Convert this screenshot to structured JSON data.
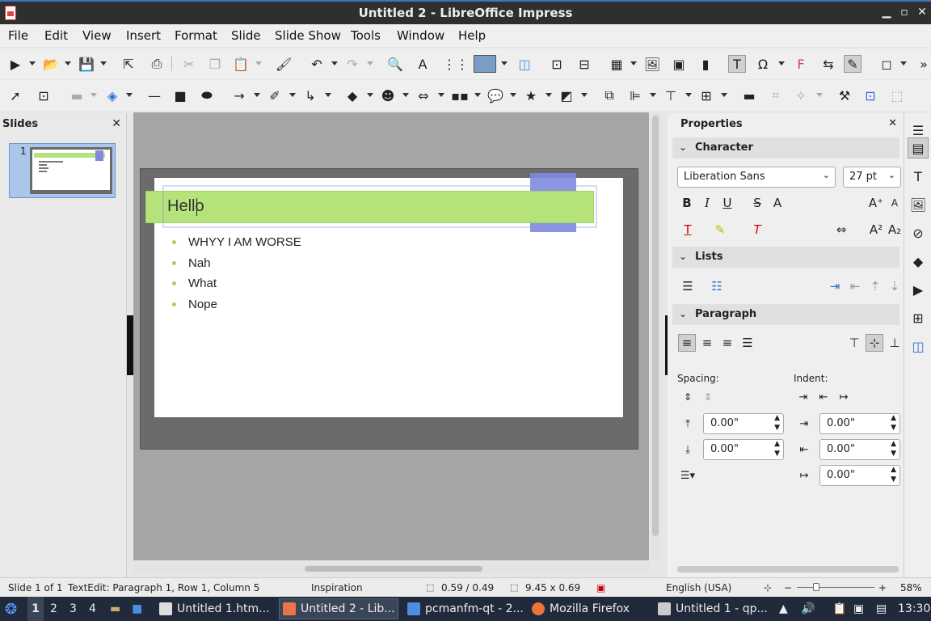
{
  "window": {
    "title": "Untitled 2 - LibreOffice Impress"
  },
  "menu": [
    "File",
    "Edit",
    "View",
    "Insert",
    "Format",
    "Slide",
    "Slide Show",
    "Tools",
    "Window",
    "Help"
  ],
  "slides_panel": {
    "title": "Slides",
    "slide_number": "1"
  },
  "slide": {
    "title": "Hello",
    "bullets": [
      "WHYY I AM WORSE",
      "Nah",
      "What",
      "Nope"
    ]
  },
  "properties": {
    "title": "Properties",
    "character": {
      "label": "Character",
      "font": "Liberation Sans",
      "size": "27 pt"
    },
    "lists": {
      "label": "Lists"
    },
    "paragraph": {
      "label": "Paragraph"
    },
    "spacing_label": "Spacing:",
    "indent_label": "Indent:",
    "spacing_above": "0.00\"",
    "spacing_below": "0.00\"",
    "indent_before": "0.00\"",
    "indent_after": "0.00\"",
    "indent_first": "0.00\""
  },
  "status": {
    "slide": "Slide 1 of 1",
    "edit": "TextEdit: Paragraph 1, Row 1, Column 5",
    "master": "Inspiration",
    "position": "0.59 / 0.49",
    "size": "9.45 x 0.69",
    "language": "English (USA)",
    "zoom": "58%"
  },
  "taskbar": {
    "workspaces": [
      "1",
      "2",
      "3",
      "4"
    ],
    "tasks": [
      "Untitled 1.htm...",
      "Untitled 2 - Lib...",
      "pcmanfm-qt - 2...",
      "Mozilla Firefox",
      "Untitled 1 - qp..."
    ],
    "clock": "13:30"
  }
}
